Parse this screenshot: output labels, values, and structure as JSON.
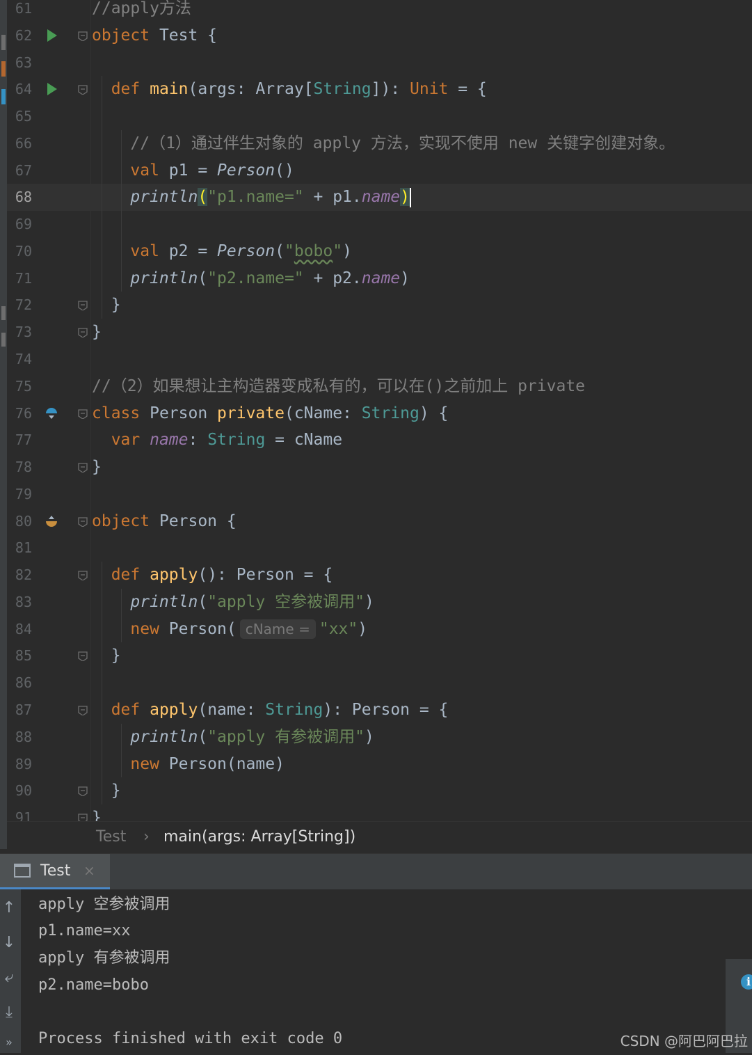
{
  "editor": {
    "current_line": "68",
    "lines": [
      {
        "num": "61",
        "segments": [
          {
            "t": "//apply方法",
            "c": "cm"
          }
        ]
      },
      {
        "num": "62",
        "segments": [
          {
            "t": "object",
            "c": "kw"
          },
          {
            "t": " Test {",
            "c": ""
          }
        ]
      },
      {
        "num": "63",
        "segments": []
      },
      {
        "num": "64",
        "segments": [
          {
            "t": "  ",
            "c": ""
          },
          {
            "t": "def",
            "c": "kw"
          },
          {
            "t": " ",
            "c": ""
          },
          {
            "t": "main",
            "c": "fn"
          },
          {
            "t": "(args: Array[",
            "c": ""
          },
          {
            "t": "String",
            "c": "ty"
          },
          {
            "t": "]): ",
            "c": ""
          },
          {
            "t": "Unit",
            "c": "kw"
          },
          {
            "t": " = {",
            "c": ""
          }
        ]
      },
      {
        "num": "65",
        "segments": []
      },
      {
        "num": "66",
        "segments": [
          {
            "t": "    //（1）通过伴生对象的 apply 方法，实现不使用 new 关键字创建对象。",
            "c": "cm"
          }
        ]
      },
      {
        "num": "67",
        "segments": [
          {
            "t": "    ",
            "c": ""
          },
          {
            "t": "val",
            "c": "kw"
          },
          {
            "t": " p1 = ",
            "c": ""
          },
          {
            "t": "Person",
            "c": "it"
          },
          {
            "t": "()",
            "c": ""
          }
        ]
      },
      {
        "num": "68",
        "segments": [
          {
            "t": "    ",
            "c": ""
          },
          {
            "t": "println",
            "c": "it"
          },
          {
            "t": "(",
            "c": "paren-hl"
          },
          {
            "t": "\"p1.name=\"",
            "c": "str"
          },
          {
            "t": " + p1.",
            "c": ""
          },
          {
            "t": "name",
            "c": "field"
          },
          {
            "t": ")",
            "c": "paren-hl"
          }
        ]
      },
      {
        "num": "69",
        "segments": []
      },
      {
        "num": "70",
        "segments": [
          {
            "t": "    ",
            "c": ""
          },
          {
            "t": "val",
            "c": "kw"
          },
          {
            "t": " p2 = ",
            "c": ""
          },
          {
            "t": "Person",
            "c": "it"
          },
          {
            "t": "(",
            "c": ""
          },
          {
            "t": "\"",
            "c": "str"
          },
          {
            "t": "bobo",
            "c": "str squiggle"
          },
          {
            "t": "\"",
            "c": "str"
          },
          {
            "t": ")",
            "c": ""
          }
        ]
      },
      {
        "num": "71",
        "segments": [
          {
            "t": "    ",
            "c": ""
          },
          {
            "t": "println",
            "c": "it"
          },
          {
            "t": "(",
            "c": ""
          },
          {
            "t": "\"p2.name=\"",
            "c": "str"
          },
          {
            "t": " + p2.",
            "c": ""
          },
          {
            "t": "name",
            "c": "field"
          },
          {
            "t": ")",
            "c": ""
          }
        ]
      },
      {
        "num": "72",
        "segments": [
          {
            "t": "  }",
            "c": ""
          }
        ]
      },
      {
        "num": "73",
        "segments": [
          {
            "t": "}",
            "c": ""
          }
        ]
      },
      {
        "num": "74",
        "segments": []
      },
      {
        "num": "75",
        "segments": [
          {
            "t": "//（2）如果想让主构造器变成私有的，可以在()之前加上 private",
            "c": "cm"
          }
        ]
      },
      {
        "num": "76",
        "segments": [
          {
            "t": "class",
            "c": "kw"
          },
          {
            "t": " Person ",
            "c": ""
          },
          {
            "t": "private",
            "c": "fn"
          },
          {
            "t": "(cName: ",
            "c": ""
          },
          {
            "t": "String",
            "c": "ty"
          },
          {
            "t": ") {",
            "c": ""
          }
        ]
      },
      {
        "num": "77",
        "segments": [
          {
            "t": "  ",
            "c": ""
          },
          {
            "t": "var",
            "c": "kw"
          },
          {
            "t": " ",
            "c": ""
          },
          {
            "t": "name",
            "c": "field"
          },
          {
            "t": ": ",
            "c": ""
          },
          {
            "t": "String",
            "c": "ty"
          },
          {
            "t": " = cName",
            "c": ""
          }
        ]
      },
      {
        "num": "78",
        "segments": [
          {
            "t": "}",
            "c": ""
          }
        ]
      },
      {
        "num": "79",
        "segments": []
      },
      {
        "num": "80",
        "segments": [
          {
            "t": "object",
            "c": "kw"
          },
          {
            "t": " Person {",
            "c": ""
          }
        ]
      },
      {
        "num": "81",
        "segments": []
      },
      {
        "num": "82",
        "segments": [
          {
            "t": "  ",
            "c": ""
          },
          {
            "t": "def",
            "c": "kw"
          },
          {
            "t": " ",
            "c": ""
          },
          {
            "t": "apply",
            "c": "fn"
          },
          {
            "t": "(): Person = {",
            "c": ""
          }
        ]
      },
      {
        "num": "83",
        "segments": [
          {
            "t": "    ",
            "c": ""
          },
          {
            "t": "println",
            "c": "it"
          },
          {
            "t": "(",
            "c": ""
          },
          {
            "t": "\"apply 空参被调用\"",
            "c": "str"
          },
          {
            "t": ")",
            "c": ""
          }
        ]
      },
      {
        "num": "84",
        "segments": [
          {
            "t": "    ",
            "c": ""
          },
          {
            "t": "new",
            "c": "kw"
          },
          {
            "t": " Person(",
            "c": ""
          },
          {
            "t": "cName =",
            "c": "hint"
          },
          {
            "t": "\"xx\"",
            "c": "str"
          },
          {
            "t": ")",
            "c": ""
          }
        ]
      },
      {
        "num": "85",
        "segments": [
          {
            "t": "  }",
            "c": ""
          }
        ]
      },
      {
        "num": "86",
        "segments": []
      },
      {
        "num": "87",
        "segments": [
          {
            "t": "  ",
            "c": ""
          },
          {
            "t": "def",
            "c": "kw"
          },
          {
            "t": " ",
            "c": ""
          },
          {
            "t": "apply",
            "c": "fn"
          },
          {
            "t": "(name: ",
            "c": ""
          },
          {
            "t": "String",
            "c": "ty"
          },
          {
            "t": "): Person = {",
            "c": ""
          }
        ]
      },
      {
        "num": "88",
        "segments": [
          {
            "t": "    ",
            "c": ""
          },
          {
            "t": "println",
            "c": "it"
          },
          {
            "t": "(",
            "c": ""
          },
          {
            "t": "\"apply 有参被调用\"",
            "c": "str"
          },
          {
            "t": ")",
            "c": ""
          }
        ]
      },
      {
        "num": "89",
        "segments": [
          {
            "t": "    ",
            "c": ""
          },
          {
            "t": "new",
            "c": "kw"
          },
          {
            "t": " Person(name)",
            "c": ""
          }
        ]
      },
      {
        "num": "90",
        "segments": [
          {
            "t": "  }",
            "c": ""
          }
        ]
      },
      {
        "num": "91",
        "segments": [
          {
            "t": "}",
            "c": ""
          }
        ]
      }
    ],
    "run_icon_lines": [
      "62",
      "64"
    ],
    "fold_lines": [
      "62",
      "64",
      "72",
      "73",
      "76",
      "78",
      "80",
      "82",
      "85",
      "87",
      "90",
      "91"
    ],
    "override_icons": {
      "76": "implemented-icon",
      "80": "implements-icon"
    },
    "colors": {
      "keyword": "#cc7832",
      "string": "#6a8759",
      "comment": "#808080",
      "type": "#4e9a96",
      "function": "#ffc66d",
      "field": "#9876aa"
    }
  },
  "breadcrumb": {
    "item1": "Test",
    "separator": "›",
    "item2": "main(args: Array[String])"
  },
  "run_panel": {
    "tab_label": "Test",
    "close_glyph": "×",
    "output": [
      "apply 空参被调用",
      "p1.name=xx",
      "apply 有参被调用",
      "p2.name=bobo",
      "",
      "Process finished with exit code 0"
    ]
  },
  "watermark": "CSDN @阿巴阿巴拉"
}
